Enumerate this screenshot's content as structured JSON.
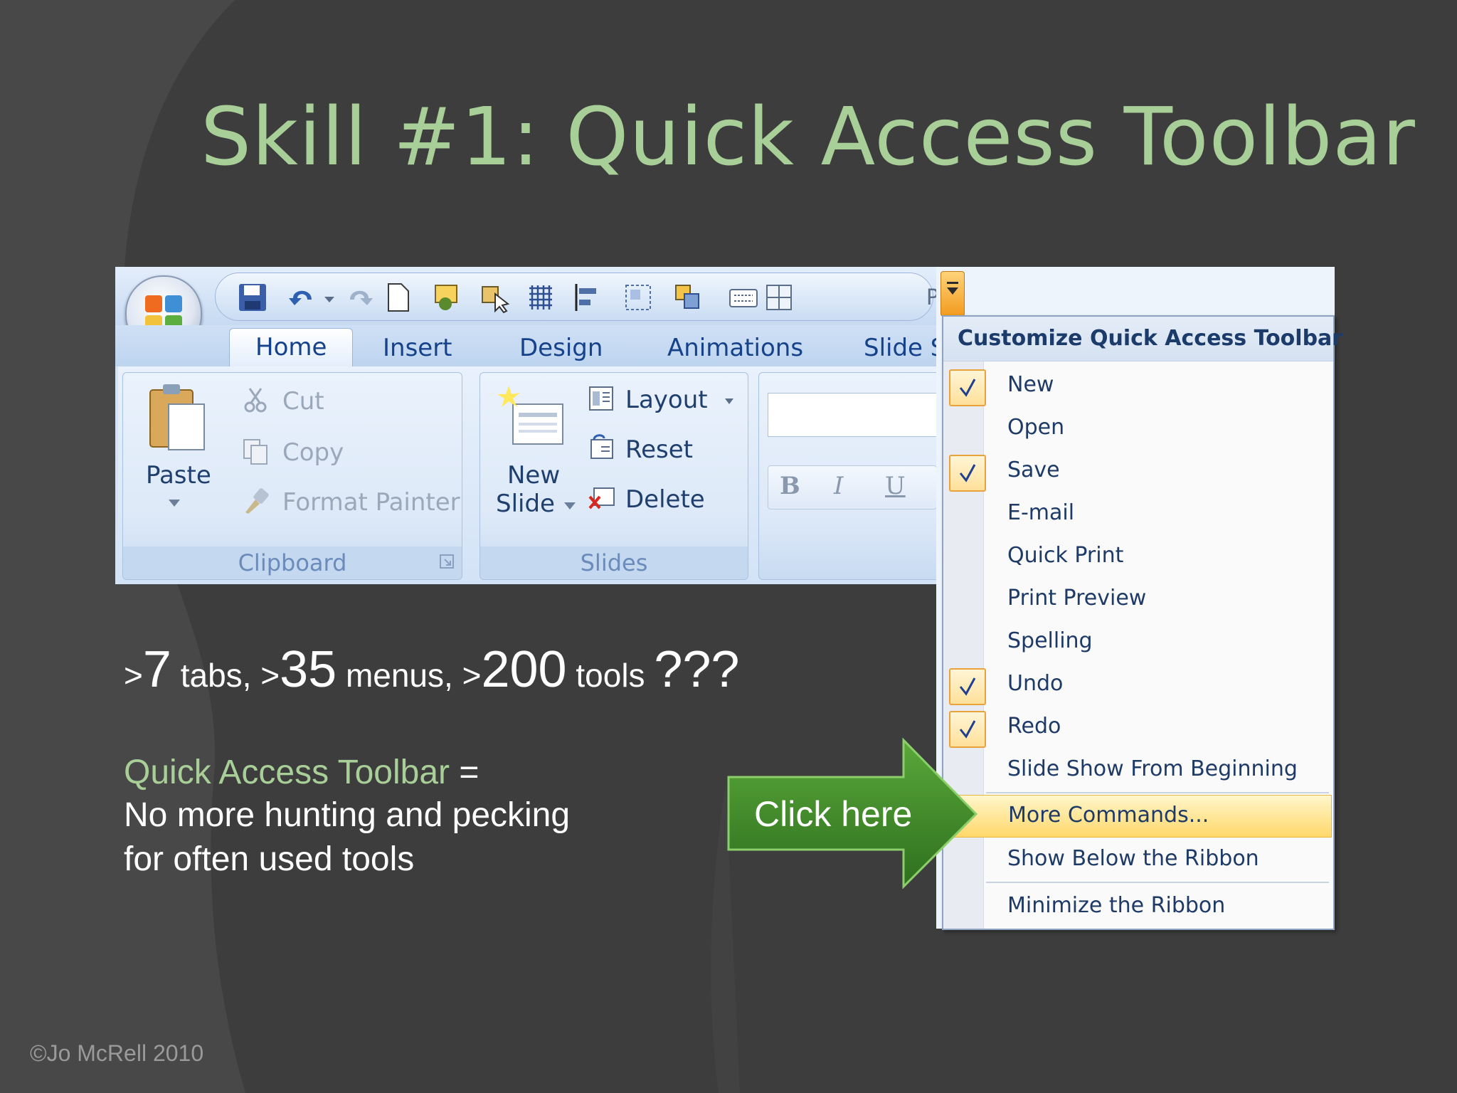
{
  "slide": {
    "title": "Skill #1: Quick Access Toolbar",
    "footer": "©Jo McRell 2010"
  },
  "ribbon": {
    "tabs": [
      "Home",
      "Insert",
      "Design",
      "Animations",
      "Slide S"
    ],
    "active_tab": "Home",
    "clipboard": {
      "paste": "Paste",
      "cut": "Cut",
      "copy": "Copy",
      "format_painter": "Format Painter",
      "group_label": "Clipboard"
    },
    "slides": {
      "new_slide_line1": "New",
      "new_slide_line2": "Slide",
      "layout": "Layout",
      "reset": "Reset",
      "delete": "Delete",
      "group_label": "Slides"
    },
    "font": {
      "bold": "B",
      "italic": "I",
      "underline": "U"
    },
    "cut_off_letter": "P"
  },
  "menu": {
    "header": "Customize Quick Access Toolbar",
    "items": [
      {
        "label": "New",
        "checked": true
      },
      {
        "label": "Open",
        "checked": false
      },
      {
        "label": "Save",
        "checked": true
      },
      {
        "label": "E-mail",
        "checked": false
      },
      {
        "label": "Quick Print",
        "checked": false
      },
      {
        "label": "Print Preview",
        "checked": false
      },
      {
        "label": "Spelling",
        "checked": false
      },
      {
        "label": "Undo",
        "checked": true
      },
      {
        "label": "Redo",
        "checked": true
      },
      {
        "label": "Slide Show From Beginning",
        "checked": false
      }
    ],
    "more_commands": "More Commands...",
    "show_below": "Show Below the Ribbon",
    "minimize": "Minimize the Ribbon"
  },
  "body": {
    "stats": {
      "p1": ">",
      "n1": "7",
      "p2": " tabs, >",
      "n2": "35",
      "p3": " menus, >",
      "n3": "200",
      "p4": " tools ",
      "q": "???"
    },
    "definition": {
      "term": "Quick Access Toolbar",
      "equals": " =",
      "line2": "No more hunting and pecking",
      "line3": "for often used tools"
    },
    "callout": "Click here"
  },
  "colors": {
    "background": "#3d3d3d",
    "title_green": "#a9cf98",
    "arrow_green": "#3f8a2a"
  }
}
